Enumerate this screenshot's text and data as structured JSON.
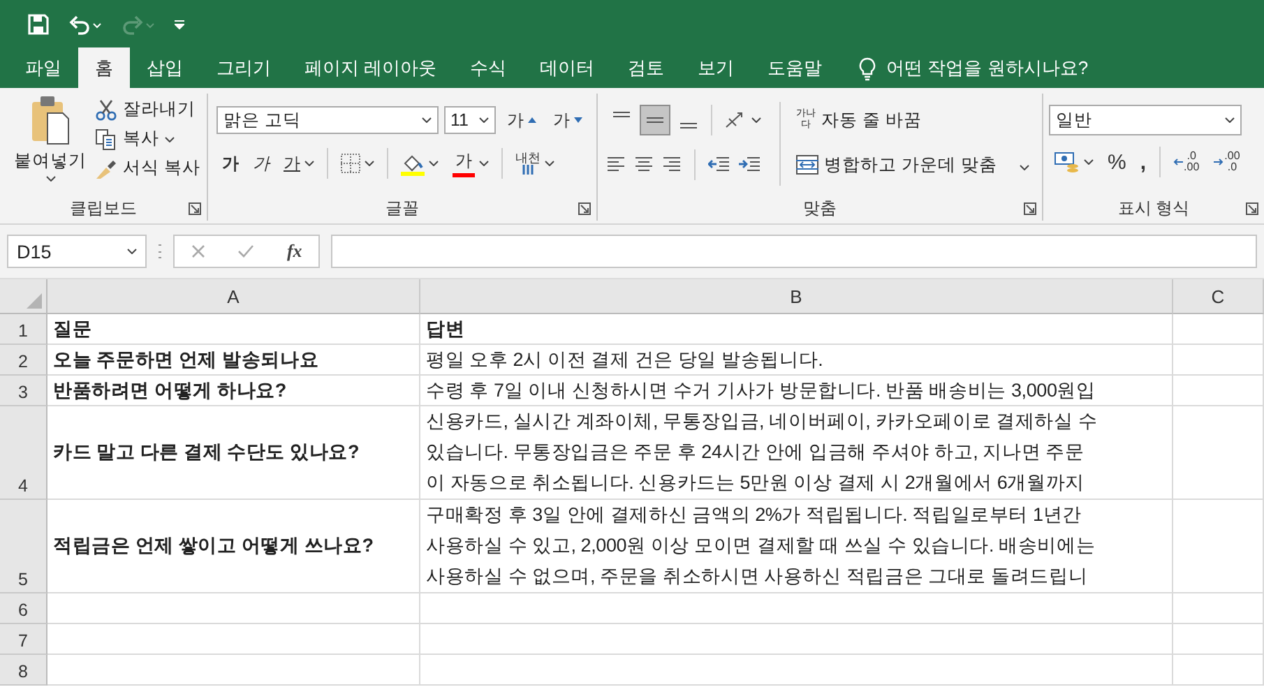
{
  "tabs": [
    {
      "label": "파일",
      "selected": false
    },
    {
      "label": "홈",
      "selected": true
    },
    {
      "label": "삽입",
      "selected": false
    },
    {
      "label": "그리기",
      "selected": false
    },
    {
      "label": "페이지 레이아웃",
      "selected": false
    },
    {
      "label": "수식",
      "selected": false
    },
    {
      "label": "데이터",
      "selected": false
    },
    {
      "label": "검토",
      "selected": false
    },
    {
      "label": "보기",
      "selected": false
    },
    {
      "label": "도움말",
      "selected": false
    }
  ],
  "tell_me": "어떤 작업을 원하시나요?",
  "clipboard": {
    "paste": "붙여넣기",
    "cut": "잘라내기",
    "copy": "복사",
    "format_painter": "서식 복사",
    "label": "클립보드"
  },
  "font": {
    "name": "맑은 고딕",
    "size": "11",
    "grow": "가",
    "shrink": "가",
    "bold": "가",
    "italic": "가",
    "underline": "가",
    "font_color": "가",
    "phonetic": "내천",
    "label": "글꼴"
  },
  "alignment": {
    "vertical": [
      {
        "selected": false
      },
      {
        "selected": true
      },
      {
        "selected": false
      }
    ],
    "wrap_icon": "가나다",
    "wrap": "자동 줄 바꿈",
    "merge": "병합하고 가운데 맞춤",
    "label": "맞춤"
  },
  "number": {
    "format": "일반",
    "percent": "%",
    "comma": ",",
    "increase_decimal": [
      ".0",
      ".00"
    ],
    "decrease_decimal": [
      ".00",
      ".0"
    ],
    "label": "표시 형식"
  },
  "formula_bar": {
    "name_box": "D15",
    "function_label": "fx"
  },
  "sheet": {
    "columns": [
      "A",
      "B",
      "C"
    ],
    "rows": [
      {
        "number": "1",
        "cells": [
          {
            "lines": [
              "질문"
            ],
            "bold": true
          },
          {
            "lines": [
              "답변"
            ],
            "bold": true
          }
        ]
      },
      {
        "number": "2",
        "cells": [
          {
            "lines": [
              "오늘 주문하면 언제 발송되나요"
            ],
            "bold": true
          },
          {
            "lines": [
              "평일 오후 2시 이전 결제 건은 당일 발송됩니다."
            ],
            "bold": false
          }
        ]
      },
      {
        "number": "3",
        "cells": [
          {
            "lines": [
              "반품하려면 어떻게 하나요?"
            ],
            "bold": true
          },
          {
            "lines": [
              "수령 후 7일 이내 신청하시면 수거 기사가 방문합니다. 반품 배송비는 3,000원입"
            ],
            "bold": false
          }
        ]
      },
      {
        "number": "4",
        "cells": [
          {
            "lines": [
              "카드 말고 다른 결제 수단도 있나요?"
            ],
            "bold": true
          },
          {
            "lines": [
              "신용카드, 실시간 계좌이체, 무통장입금, 네이버페이, 카카오페이로 결제하실 수",
              "있습니다. 무통장입금은 주문 후 24시간 안에 입금해 주셔야 하고, 지나면 주문",
              "이 자동으로 취소됩니다. 신용카드는 5만원 이상 결제 시 2개월에서 6개월까지"
            ],
            "bold": false
          }
        ]
      },
      {
        "number": "5",
        "cells": [
          {
            "lines": [
              "적립금은 언제 쌓이고 어떻게 쓰나요?"
            ],
            "bold": true
          },
          {
            "lines": [
              "구매확정 후 3일 안에 결제하신 금액의 2%가 적립됩니다. 적립일로부터 1년간",
              "사용하실 수 있고, 2,000원 이상 모이면 결제할 때 쓰실 수 있습니다. 배송비에는",
              "사용하실 수 없으며, 주문을 취소하시면 사용하신 적립금은 그대로 돌려드립니"
            ],
            "bold": false
          }
        ]
      },
      {
        "number": "6"
      },
      {
        "number": "7"
      },
      {
        "number": "8"
      }
    ]
  }
}
